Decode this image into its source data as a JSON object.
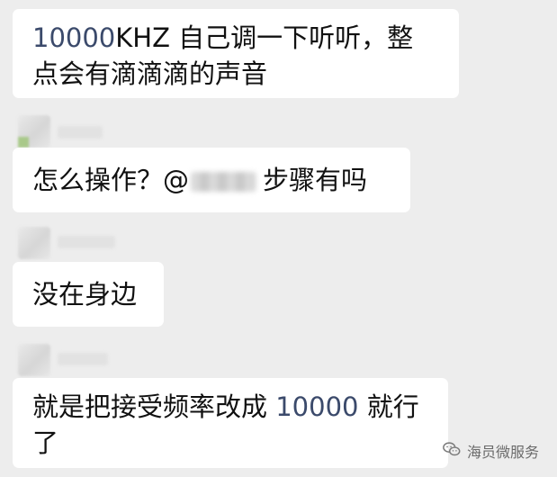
{
  "messages": [
    {
      "segments": [
        "10000",
        "KHZ 自己调一下听听，整",
        "点会有滴滴滴的声音"
      ]
    },
    {
      "text_before": "怎么操作？@",
      "text_after": "步骤有吗"
    },
    {
      "text": "没在身边"
    },
    {
      "segments": [
        "就是把接受频率改成 ",
        "10000",
        " 就行",
        "了"
      ]
    }
  ],
  "watermark": {
    "text": "海员微服务",
    "icon": "wechat-icon"
  },
  "colors": {
    "background": "#ededed",
    "bubble": "#ffffff",
    "number_accent": "#3b4a6b"
  }
}
